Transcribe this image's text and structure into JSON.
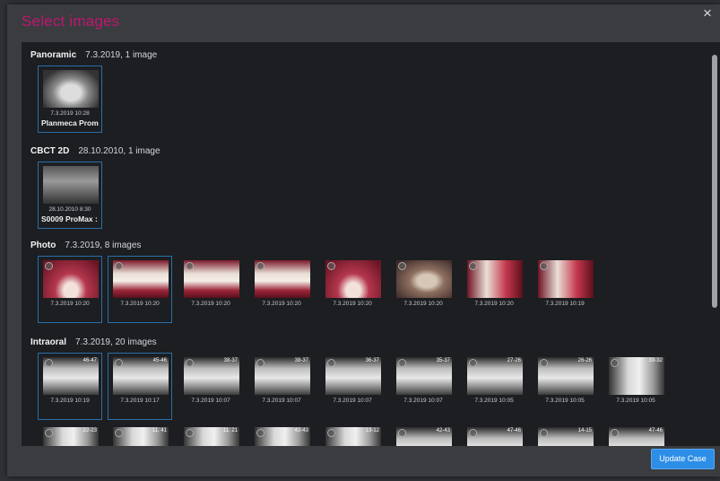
{
  "dialog": {
    "title": "Select images",
    "close_label": "×",
    "update_label": "Update Case"
  },
  "sections": [
    {
      "name": "Panoramic",
      "meta": "7.3.2019, 1 image",
      "thumbs": [
        {
          "timestamp": "7.3.2019 10:28",
          "caption": "Planmeca Prom",
          "style": "pano",
          "selected": true
        }
      ]
    },
    {
      "name": "CBCT 2D",
      "meta": "28.10.2010, 1 image",
      "thumbs": [
        {
          "timestamp": "28.10.2010 8:30",
          "caption": "S0009 ProMax :",
          "style": "cbct",
          "selected": true
        }
      ]
    },
    {
      "name": "Photo",
      "meta": "7.3.2019, 8 images",
      "thumbs": [
        {
          "timestamp": "7.3.2019 10:20",
          "style": "photo-a",
          "selected": true
        },
        {
          "timestamp": "7.3.2019 10:20",
          "style": "photo-b",
          "selected": true
        },
        {
          "timestamp": "7.3.2019 10:20",
          "style": "photo-b",
          "selected": false
        },
        {
          "timestamp": "7.3.2019 10:20",
          "style": "photo-b",
          "selected": false
        },
        {
          "timestamp": "7.3.2019 10:20",
          "style": "photo-a",
          "selected": false
        },
        {
          "timestamp": "7.3.2019 10:20",
          "style": "photo-c",
          "selected": false
        },
        {
          "timestamp": "7.3.2019 10:20",
          "style": "photo-d",
          "selected": false
        },
        {
          "timestamp": "7.3.2019 10:19",
          "style": "photo-d",
          "selected": false
        }
      ]
    },
    {
      "name": "Intraoral",
      "meta": "7.3.2019, 20 images",
      "thumbs": [
        {
          "timestamp": "7.3.2019 10:19",
          "tooth": "46-47",
          "style": "xray",
          "selected": true
        },
        {
          "timestamp": "7.3.2019 10:17",
          "tooth": "45-46",
          "style": "xray",
          "selected": true
        },
        {
          "timestamp": "7.3.2019 10:07",
          "tooth": "38-37",
          "style": "xray",
          "selected": false
        },
        {
          "timestamp": "7.3.2019 10:07",
          "tooth": "38-37",
          "style": "xray",
          "selected": false
        },
        {
          "timestamp": "7.3.2019 10:07",
          "tooth": "36-37",
          "style": "xray",
          "selected": false
        },
        {
          "timestamp": "7.3.2019 10:07",
          "tooth": "35-37",
          "style": "xray",
          "selected": false
        },
        {
          "timestamp": "7.3.2019 10:05",
          "tooth": "27-26",
          "style": "xray",
          "selected": false
        },
        {
          "timestamp": "7.3.2019 10:05",
          "tooth": "26-26",
          "style": "xray",
          "selected": false
        },
        {
          "timestamp": "7.3.2019 10:05",
          "tooth": "33-32",
          "style": "xray-v",
          "selected": false
        },
        {
          "timestamp": "",
          "tooth": "22-23",
          "style": "xray-v",
          "selected": false
        },
        {
          "timestamp": "",
          "tooth": "11, 41",
          "style": "xray-v",
          "selected": false
        },
        {
          "timestamp": "",
          "tooth": "11, 21",
          "style": "xray-v",
          "selected": false
        },
        {
          "timestamp": "",
          "tooth": "42-43",
          "style": "xray-v",
          "selected": false
        },
        {
          "timestamp": "",
          "tooth": "13-12",
          "style": "xray-v",
          "selected": false
        },
        {
          "timestamp": "",
          "tooth": "42-43",
          "style": "xray",
          "selected": false
        },
        {
          "timestamp": "",
          "tooth": "47-46",
          "style": "xray",
          "selected": false
        },
        {
          "timestamp": "",
          "tooth": "14-15",
          "style": "xray",
          "selected": false
        },
        {
          "timestamp": "",
          "tooth": "47-46",
          "style": "xray",
          "selected": false
        }
      ]
    }
  ]
}
